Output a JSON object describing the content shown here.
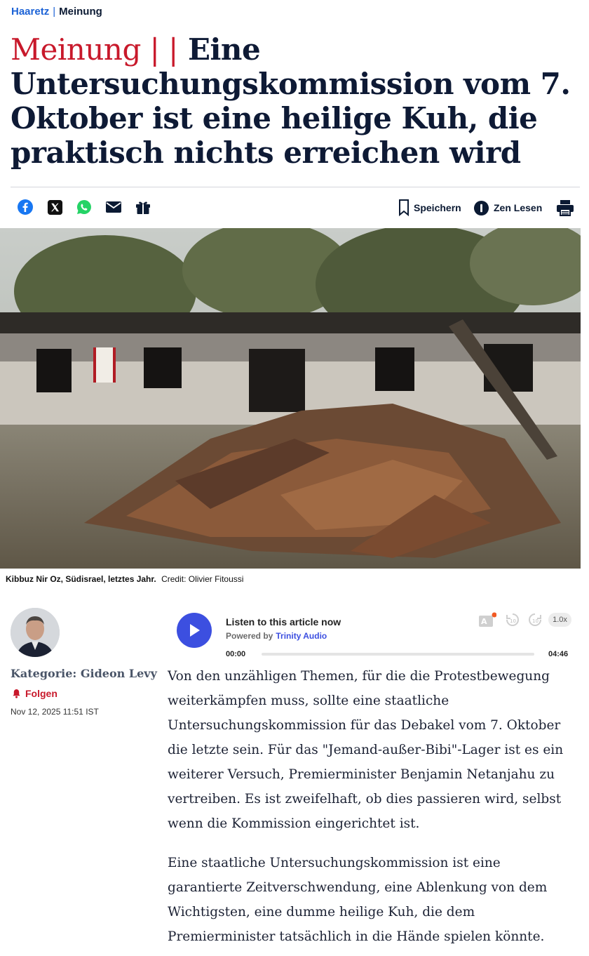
{
  "breadcrumb": {
    "brand": "Haaretz",
    "separator": "|",
    "section": "Meinung"
  },
  "headline": {
    "kicker": "Meinung | |",
    "title": "Eine Untersuchungskommission vom 7. Oktober ist eine heilige Kuh, die praktisch nichts erreichen wird"
  },
  "share": [
    {
      "icon": "facebook-icon",
      "color": "#1877f2"
    },
    {
      "icon": "x-icon",
      "color": "#111111"
    },
    {
      "icon": "whatsapp-icon",
      "color": "#25d366"
    },
    {
      "icon": "mail-icon",
      "color": "#0b1a33"
    },
    {
      "icon": "gift-icon",
      "color": "#0b1a33"
    }
  ],
  "tools": {
    "save_label": "Speichern",
    "zen_label": "Zen Lesen"
  },
  "image": {
    "caption_place": "Kibbuz Nir Oz, Südisrael, letztes Jahr.",
    "caption_credit": "Credit: Olivier Fitoussi"
  },
  "author": {
    "label": "Kategorie: Gideon Levy",
    "follow": "Folgen",
    "date": "Nov 12, 2025 11:51 IST"
  },
  "player": {
    "title": "Listen to this article now",
    "powered_by": "Powered by",
    "provider": "Trinity Audio",
    "current_time": "00:00",
    "duration": "04:46",
    "speed": "1.0x",
    "progress": 0,
    "accent": "#3c4fe0"
  },
  "body": {
    "paragraphs": [
      "Von den unzähligen Themen, für die die Protestbewegung weiterkämpfen muss, sollte eine staatliche Untersuchungskommission für das Debakel vom 7. Oktober die letzte sein. Für das \"Jemand-außer-Bibi\"-Lager ist es ein weiterer Versuch, Premierminister Benjamin Netanjahu zu vertreiben. Es ist zweifelhaft, ob dies passieren wird, selbst wenn die Kommission eingerichtet ist.",
      "Eine staatliche Untersuchungskommission ist eine garantierte Zeitverschwendung, eine Ablenkung von dem Wichtigsten, eine dumme heilige Kuh, die dem Premierminister tatsächlich in die Hände spielen könnte."
    ]
  },
  "colors": {
    "brand_blue": "#1d63d6",
    "kicker_red": "#c8192b",
    "heading_navy": "#0e1a35"
  }
}
